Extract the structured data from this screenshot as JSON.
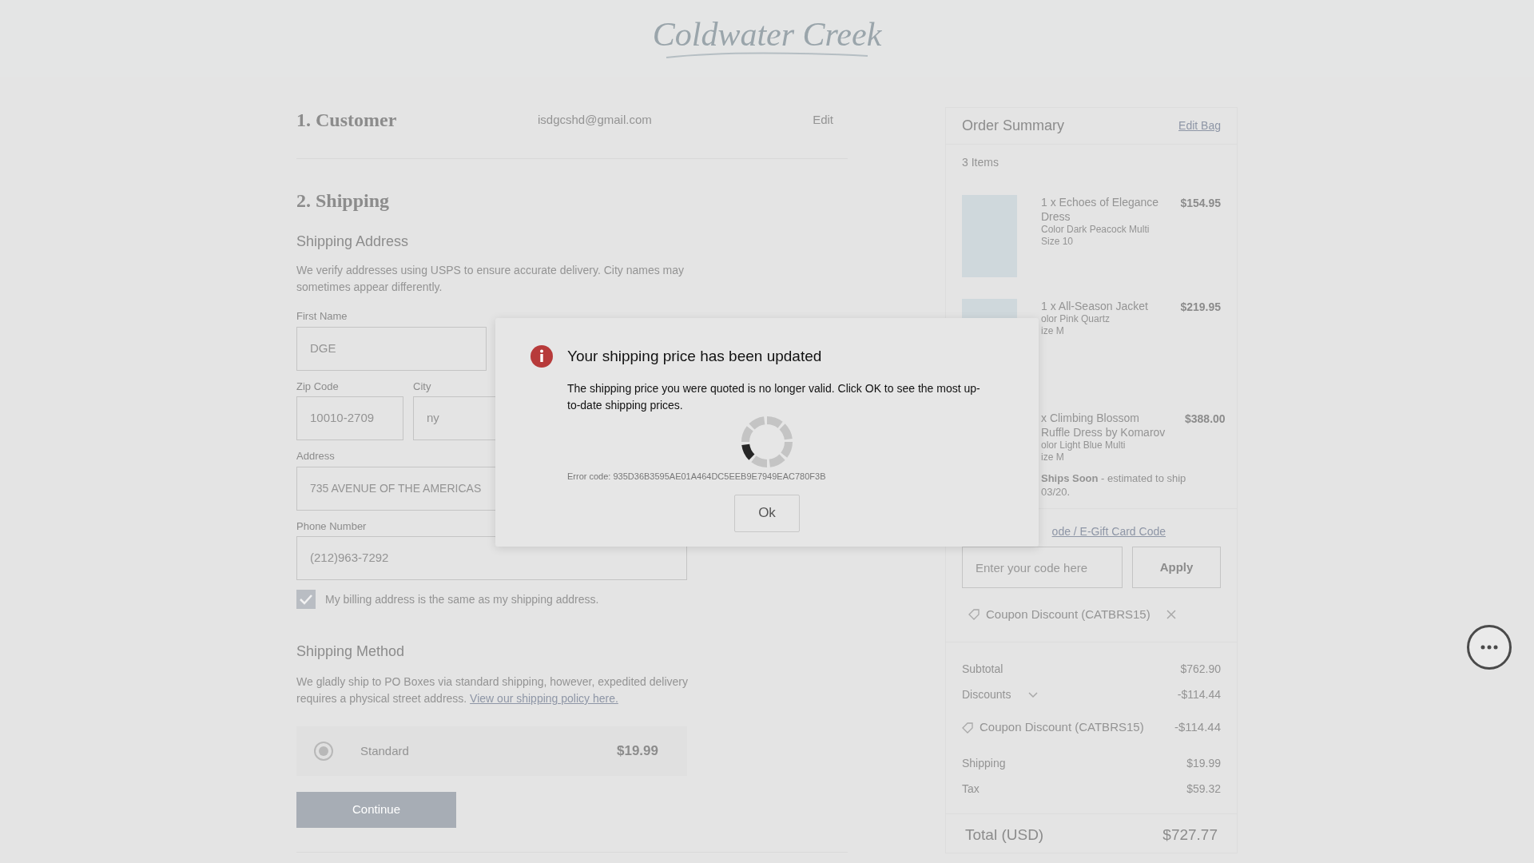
{
  "logo": "Coldwater Creek",
  "customer": {
    "title": "1. Customer",
    "email": "isdgcshd@gmail.com",
    "edit": "Edit"
  },
  "shipping": {
    "title": "2. Shipping",
    "address_heading": "Shipping Address",
    "address_note": "We verify addresses using USPS to ensure accurate delivery. City names may sometimes appear differently.",
    "first_name": {
      "label": "First Name",
      "value": "DGE"
    },
    "zip": {
      "label": "Zip Code",
      "value": "10010-2709"
    },
    "city": {
      "label": "City",
      "value": "ny"
    },
    "address": {
      "label": "Address",
      "value": "735 AVENUE OF THE AMERICAS"
    },
    "phone": {
      "label": "Phone Number",
      "value": "(212)963-7292"
    },
    "billing_same": {
      "label": "My billing address is the same as my shipping address.",
      "checked": true
    },
    "method_heading": "Shipping Method",
    "method_note": "We gladly ship to PO Boxes via standard shipping, however, expedited delivery requires a physical street address.",
    "policy_link": "View our shipping policy here.",
    "options": [
      {
        "label": "Standard",
        "price": "$19.99",
        "selected": true
      }
    ],
    "continue": "Continue"
  },
  "summary": {
    "title": "Order Summary",
    "edit_link": "Edit Bag",
    "count": "3 Items",
    "items": [
      {
        "name": "1 x Echoes of Elegance Dress",
        "variant": "Color Dark Peacock Multi",
        "size": "Size 10",
        "price": "$154.95"
      },
      {
        "name": "1 x All-Season Jacket",
        "variant": "olor Pink Quartz",
        "size": "ize M",
        "price": "$219.95"
      },
      {
        "name": "x Climbing Blossom Ruffle Dress by Komarov",
        "variant": "olor Light Blue Multi",
        "size": "ize M",
        "price": "$388.00",
        "note": "**Ships Soon** - estimated to ship 03/20."
      }
    ],
    "promo": {
      "link": "ode / E-Gift Card Code",
      "placeholder": "Enter your code here",
      "apply": "Apply",
      "applied": "Coupon Discount (CATBRS15)"
    },
    "totals": [
      {
        "kind": "line",
        "label": "Subtotal",
        "value": "$762.90"
      },
      {
        "kind": "toggle",
        "label": "Discounts",
        "value": "-$114.44"
      },
      {
        "kind": "coupon",
        "label": "Coupon Discount (CATBRS15)",
        "value": "-$114.44"
      },
      {
        "kind": "line",
        "label": "Shipping",
        "value": "$19.99"
      },
      {
        "kind": "line",
        "label": "Tax",
        "value": "$59.32"
      }
    ],
    "total": {
      "label": "Total (USD)",
      "value": "$727.77"
    }
  },
  "dialog": {
    "title": "Your shipping price has been updated",
    "message": "The shipping price you were quoted is no longer valid. Click OK to see the most up-to-date shipping prices.",
    "error": "Error code: 935D36B3595AE01A464DC5EEB9E7949EAC780F3B",
    "ok": "Ok"
  }
}
